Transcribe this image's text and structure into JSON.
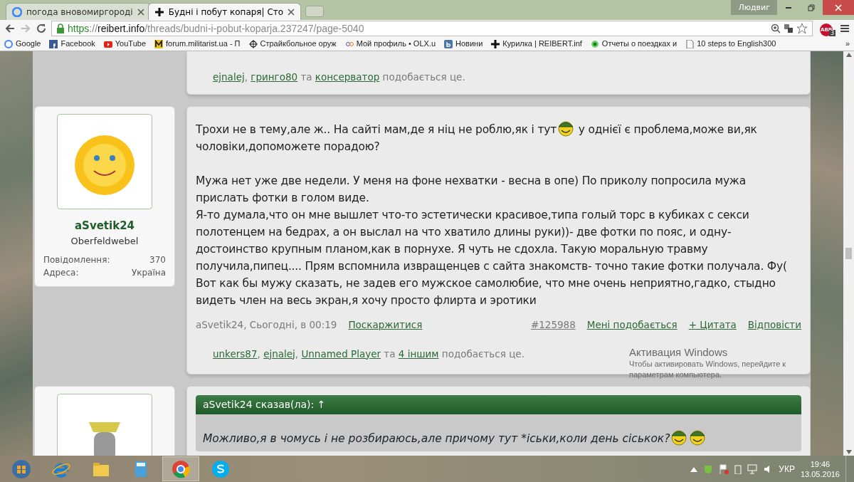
{
  "browser": {
    "tabs": [
      {
        "title": "погода вновомиргороді",
        "selected": false
      },
      {
        "title": "Будні і побут копаря| Сто",
        "selected": true
      }
    ],
    "profile": "Людвиг",
    "url": {
      "scheme": "https",
      "separator": "://",
      "host": "reibert.info",
      "path": "/threads/budni-i-pobut-koparja.237247/page-5040"
    },
    "extension_badge": {
      "label": "ABP",
      "count": "3"
    },
    "bookmarks": [
      "Google",
      "Facebook",
      "YouTube",
      "forum.militarist.ua - П",
      "Страйкбольное оруж",
      "Мой профиль • OLX.u",
      "Новини",
      "Курилка | REIBERT.inf",
      "Отчеты о поездках и",
      "10 steps to English300"
    ],
    "overflow": "»"
  },
  "posts": [
    {
      "likes": [
        {
          "text": "ejnalej",
          "kind": "link"
        },
        {
          "text": ", ",
          "kind": "plain"
        },
        {
          "text": "гринго80",
          "kind": "link"
        },
        {
          "text": " та ",
          "kind": "plain"
        },
        {
          "text": "консерватор",
          "kind": "link"
        },
        {
          "text": " подобається це.",
          "kind": "plain"
        }
      ]
    },
    {
      "user": {
        "name": "aSvetik24",
        "title": "Oberfeldwebel",
        "stats": [
          {
            "label": "Повідомлення:",
            "value": "370"
          },
          {
            "label": "Адреса:",
            "value": "Україна"
          }
        ]
      },
      "paragraph_groups": [
        [
          [
            {
              "kind": "text",
              "text": "Трохи не в тему,але ж.. На сайті мам,де я ніц не роблю,як і тут"
            },
            {
              "kind": "smiley"
            },
            {
              "kind": "text",
              "text": " у однієї є проблема,може ви,як чоловіки,допоможете порадою?"
            }
          ]
        ],
        [
          [
            {
              "kind": "text",
              "text": "Мужа нет уже две недели. У меня на фоне нехватки - весна в опе) По приколу попросила мужа прислать фотки в голом виде."
            }
          ],
          [
            {
              "kind": "text",
              "text": "Я-то думала,что он мне вышлет что-то эстетически красивое,типа голый торс в кубиках с секси полотенцем на бедрах, а он выслал на что хватило длины руки))- две фотки по пояс, и одну- достоинство крупным планом,как в порнухе. Я чуть не сдохла. Такую моральную травму получила,пипец.... Прям вспомнила извращенцев с сайта знакомств- точно такие фотки получала. Фу("
            }
          ],
          [
            {
              "kind": "text",
              "text": "Вот как бы мужу сказать, не задев его мужское самолюбие, что мне очень неприятно,гадко, стыдно видеть член на весь экран,я хочу просто флирта и эротики"
            }
          ]
        ]
      ],
      "meta": {
        "author": "aSvetik24",
        "date": ", Сьогодні, в 00:19",
        "report": "Поскаржитися",
        "number": "#125988",
        "actions": [
          "Мені подобається",
          "+ Цитата",
          "Відповісти"
        ]
      },
      "likes": [
        {
          "text": "unkers87",
          "kind": "link"
        },
        {
          "text": ", ",
          "kind": "plain"
        },
        {
          "text": "ejnalej",
          "kind": "link"
        },
        {
          "text": ", ",
          "kind": "plain"
        },
        {
          "text": "Unnamed Player",
          "kind": "link"
        },
        {
          "text": " та ",
          "kind": "plain"
        },
        {
          "text": "4 іншим",
          "kind": "link"
        },
        {
          "text": " подобається це.",
          "kind": "plain"
        }
      ]
    },
    {
      "quote": {
        "header": "aSvetik24 сказав(ла): ↑",
        "parts": [
          {
            "kind": "text",
            "text": "Можливо,я в чомусь і не розбираюсь,але причому тут *іськи,коли день сіськок?"
          },
          {
            "kind": "smiley"
          },
          {
            "kind": "smiley"
          }
        ]
      }
    }
  ],
  "activation": {
    "title": "Активация Windows",
    "lines": [
      "Чтобы активировать Windows, перейдите к",
      "параметрам компьютера."
    ]
  },
  "taskbar": {
    "apps": [
      {
        "selected": false
      },
      {
        "selected": false
      },
      {
        "selected": false
      },
      {
        "selected": false
      },
      {
        "selected": true
      },
      {
        "selected": false
      }
    ],
    "language": "УКР",
    "time": "19:46",
    "date": "13.05.2016"
  }
}
